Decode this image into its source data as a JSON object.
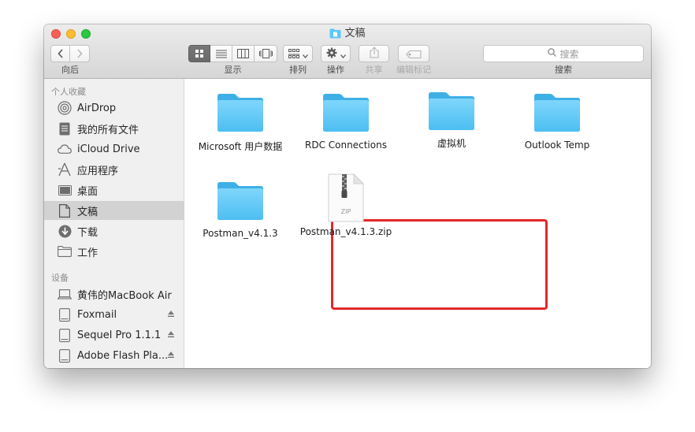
{
  "window": {
    "title": "文稿"
  },
  "toolbar": {
    "back_label": "向后",
    "view_label": "显示",
    "arrange_label": "排列",
    "action_label": "操作",
    "share_label": "共享",
    "edit_tags_label": "编辑标记",
    "search_label": "搜索",
    "search_placeholder": "搜索"
  },
  "sidebar": {
    "favorites_header": "个人收藏",
    "favorites": [
      {
        "label": "AirDrop",
        "icon": "airdrop-icon"
      },
      {
        "label": "我的所有文件",
        "icon": "all-files-icon"
      },
      {
        "label": "iCloud Drive",
        "icon": "cloud-icon"
      },
      {
        "label": "应用程序",
        "icon": "applications-icon"
      },
      {
        "label": "桌面",
        "icon": "desktop-icon"
      },
      {
        "label": "文稿",
        "icon": "documents-icon",
        "selected": true
      },
      {
        "label": "下载",
        "icon": "download-icon"
      },
      {
        "label": "工作",
        "icon": "folder-icon"
      }
    ],
    "devices_header": "设备",
    "devices": [
      {
        "label": "黄伟的MacBook Air",
        "icon": "laptop-icon"
      },
      {
        "label": "Foxmail",
        "icon": "disk-icon",
        "eject": true
      },
      {
        "label": "Sequel Pro 1.1.1",
        "icon": "disk-icon",
        "eject": true
      },
      {
        "label": "Adobe Flash Pla...",
        "icon": "disk-icon",
        "eject": true
      }
    ]
  },
  "files": [
    {
      "name": "Microsoft 用户数据",
      "type": "folder"
    },
    {
      "name": "RDC Connections",
      "type": "folder"
    },
    {
      "name": "虚拟机",
      "type": "folder"
    },
    {
      "name": "Outlook Temp",
      "type": "folder"
    },
    {
      "name": "Postman_v4.1.3",
      "type": "folder"
    },
    {
      "name": "Postman_v4.1.3.zip",
      "type": "zip",
      "badge": "ZIP"
    }
  ],
  "colors": {
    "folder": "#5ac8fa",
    "highlight": "#e32727",
    "selection": "#d2d2d2"
  }
}
